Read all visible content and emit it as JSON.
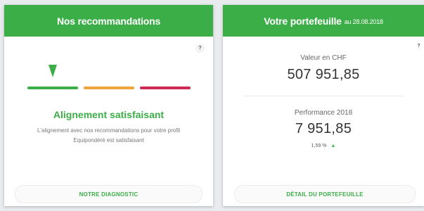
{
  "left_card": {
    "title": "Nos recommandations",
    "help": "?",
    "status_title": "Alignement satisfaisant",
    "status_desc": "L'alignement avec nos recommandations pour votre profil Equipondéré est satisfaisant",
    "button": "NOTRE DIAGNOSTIC",
    "gauge_level": "satisfaisant"
  },
  "right_card": {
    "title": "Votre portefeuille",
    "date": "au 28.08.2018",
    "help": "?",
    "value_label": "Valeur en  CHF",
    "value": "507 951,85",
    "perf_label": "Performance 2018",
    "perf_value": "7 951,85",
    "perf_pct": "1,59 %",
    "perf_arrow": "▲",
    "button": "DÉTAIL DU PORTEFEUILLE"
  },
  "colors": {
    "accent": "#3cae48",
    "warning": "#f0a53c",
    "danger": "#cc2a55"
  }
}
